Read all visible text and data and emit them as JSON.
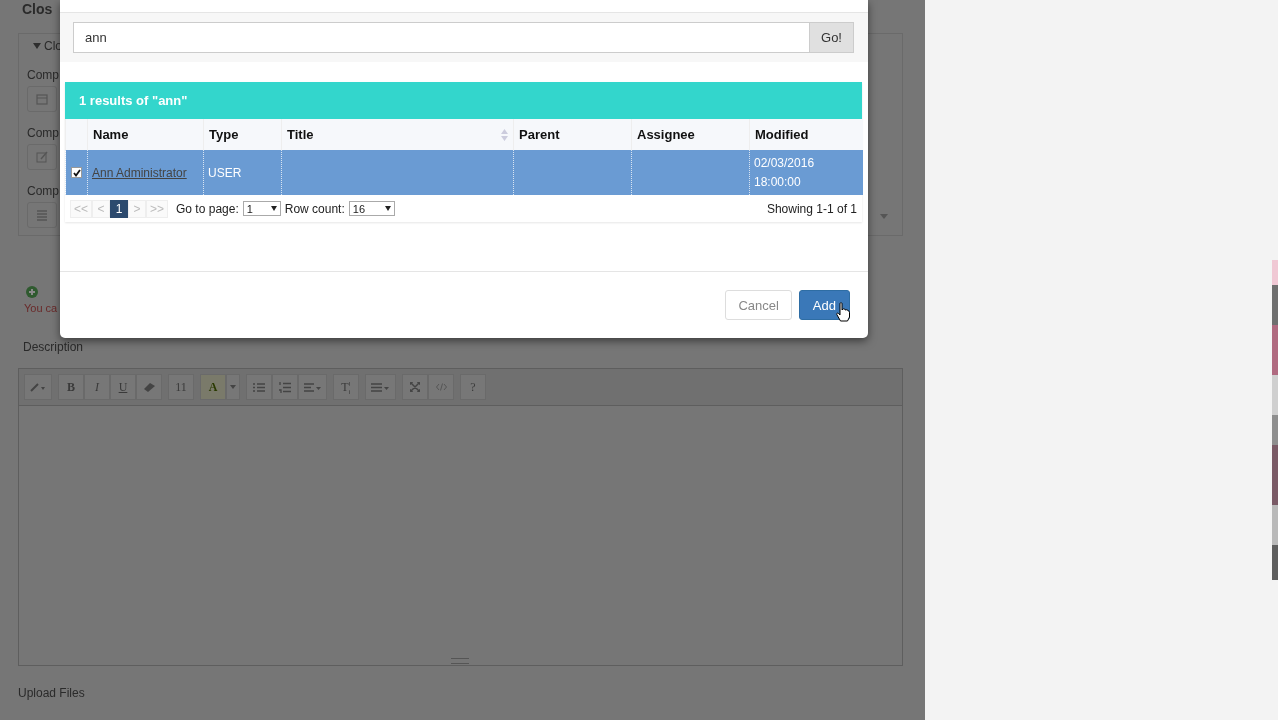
{
  "page": {
    "title": "Clos",
    "panel_title": "Clo",
    "fields": [
      {
        "label": "Comp",
        "kind": "date"
      },
      {
        "label": "Comp",
        "kind": "edit"
      },
      {
        "label": "Comp",
        "kind": "list"
      }
    ],
    "warning": "You ca",
    "description_label": "Description",
    "toolbar": [
      [
        {
          "kind": "pen"
        }
      ],
      [
        {
          "kind": "bold",
          "label": "B"
        },
        {
          "kind": "italic",
          "label": "I"
        },
        {
          "kind": "underline",
          "label": "U"
        },
        {
          "kind": "eraser"
        }
      ],
      [
        {
          "kind": "menu",
          "label": "11"
        }
      ],
      [
        {
          "kind": "color",
          "label": "A"
        },
        {
          "kind": "caret"
        }
      ],
      [
        {
          "kind": "ul"
        },
        {
          "kind": "ol"
        },
        {
          "kind": "align"
        }
      ],
      [
        {
          "kind": "menu",
          "label": "T¦"
        }
      ],
      [
        {
          "kind": "table"
        }
      ],
      [
        {
          "kind": "expand"
        },
        {
          "kind": "code"
        }
      ],
      [
        {
          "kind": "plain",
          "label": "?"
        }
      ]
    ],
    "upload_label": "Upload Files"
  },
  "modal": {
    "search": {
      "value": "ann",
      "button": "Go!"
    },
    "results": {
      "heading": "1 results of \"ann\"",
      "columns": [
        {
          "label": "Name",
          "sortable": false
        },
        {
          "label": "Type",
          "sortable": false
        },
        {
          "label": "Title",
          "sortable": true
        },
        {
          "label": "Parent",
          "sortable": false
        },
        {
          "label": "Assignee",
          "sortable": false
        },
        {
          "label": "Modified",
          "sortable": false
        }
      ],
      "rows": [
        {
          "selected": true,
          "checked": true,
          "name": "Ann Administrator",
          "type": "USER",
          "modified": [
            "02/03/2016",
            "18:00:00"
          ]
        }
      ],
      "pager": [
        {
          "label": "<<",
          "selected": false
        },
        {
          "label": "<",
          "selected": false
        },
        {
          "label": "1",
          "selected": true
        },
        {
          "label": ">",
          "selected": false
        },
        {
          "label": ">>",
          "selected": false
        }
      ],
      "go_to_label": "Go to page:",
      "go_to_value": "1",
      "row_count_label": "Row count:",
      "row_count_value": "16",
      "showing": "Showing 1-1 of 1"
    },
    "buttons": [
      {
        "label": "Cancel",
        "kind": "secondary"
      },
      {
        "label": "Add",
        "kind": "primary"
      }
    ]
  }
}
